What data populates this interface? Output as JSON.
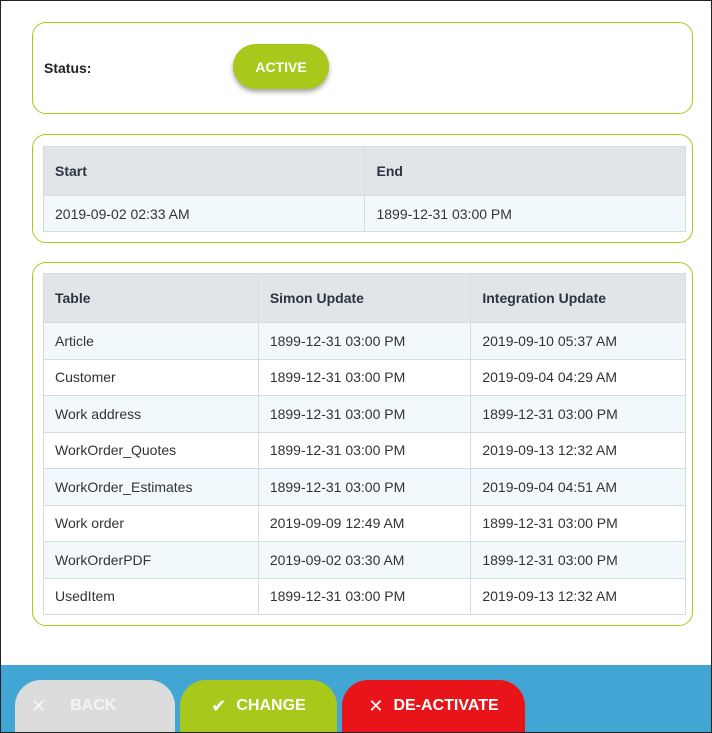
{
  "status": {
    "label": "Status:",
    "value": "ACTIVE"
  },
  "times": {
    "headers": [
      "Start",
      "End"
    ],
    "row": [
      "2019-09-02 02:33 AM",
      "1899-12-31 03:00 PM"
    ]
  },
  "tables": {
    "headers": [
      "Table",
      "Simon Update",
      "Integration Update"
    ],
    "rows": [
      [
        "Article",
        "1899-12-31 03:00 PM",
        "2019-09-10 05:37 AM"
      ],
      [
        "Customer",
        "1899-12-31 03:00 PM",
        "2019-09-04 04:29 AM"
      ],
      [
        "Work address",
        "1899-12-31 03:00 PM",
        "1899-12-31 03:00 PM"
      ],
      [
        "WorkOrder_Quotes",
        "1899-12-31 03:00 PM",
        "2019-09-13 12:32 AM"
      ],
      [
        "WorkOrder_Estimates",
        "1899-12-31 03:00 PM",
        "2019-09-04 04:51 AM"
      ],
      [
        "Work order",
        "2019-09-09 12:49 AM",
        "1899-12-31 03:00 PM"
      ],
      [
        "WorkOrderPDF",
        "2019-09-02 03:30 AM",
        "1899-12-31 03:00 PM"
      ],
      [
        "UsedItem",
        "1899-12-31 03:00 PM",
        "2019-09-13 12:32 AM"
      ]
    ]
  },
  "footer": {
    "back_label": "BACK",
    "change_label": "CHANGE",
    "deactivate_label": "DE-ACTIVATE",
    "back_icon": "close-icon",
    "change_icon": "check-icon",
    "deactivate_icon": "close-icon"
  },
  "colors": {
    "accent_green": "#a9c81c",
    "footer_blue": "#42a6d4",
    "danger_red": "#e8141a",
    "disabled_gray": "#dcdcdc"
  }
}
